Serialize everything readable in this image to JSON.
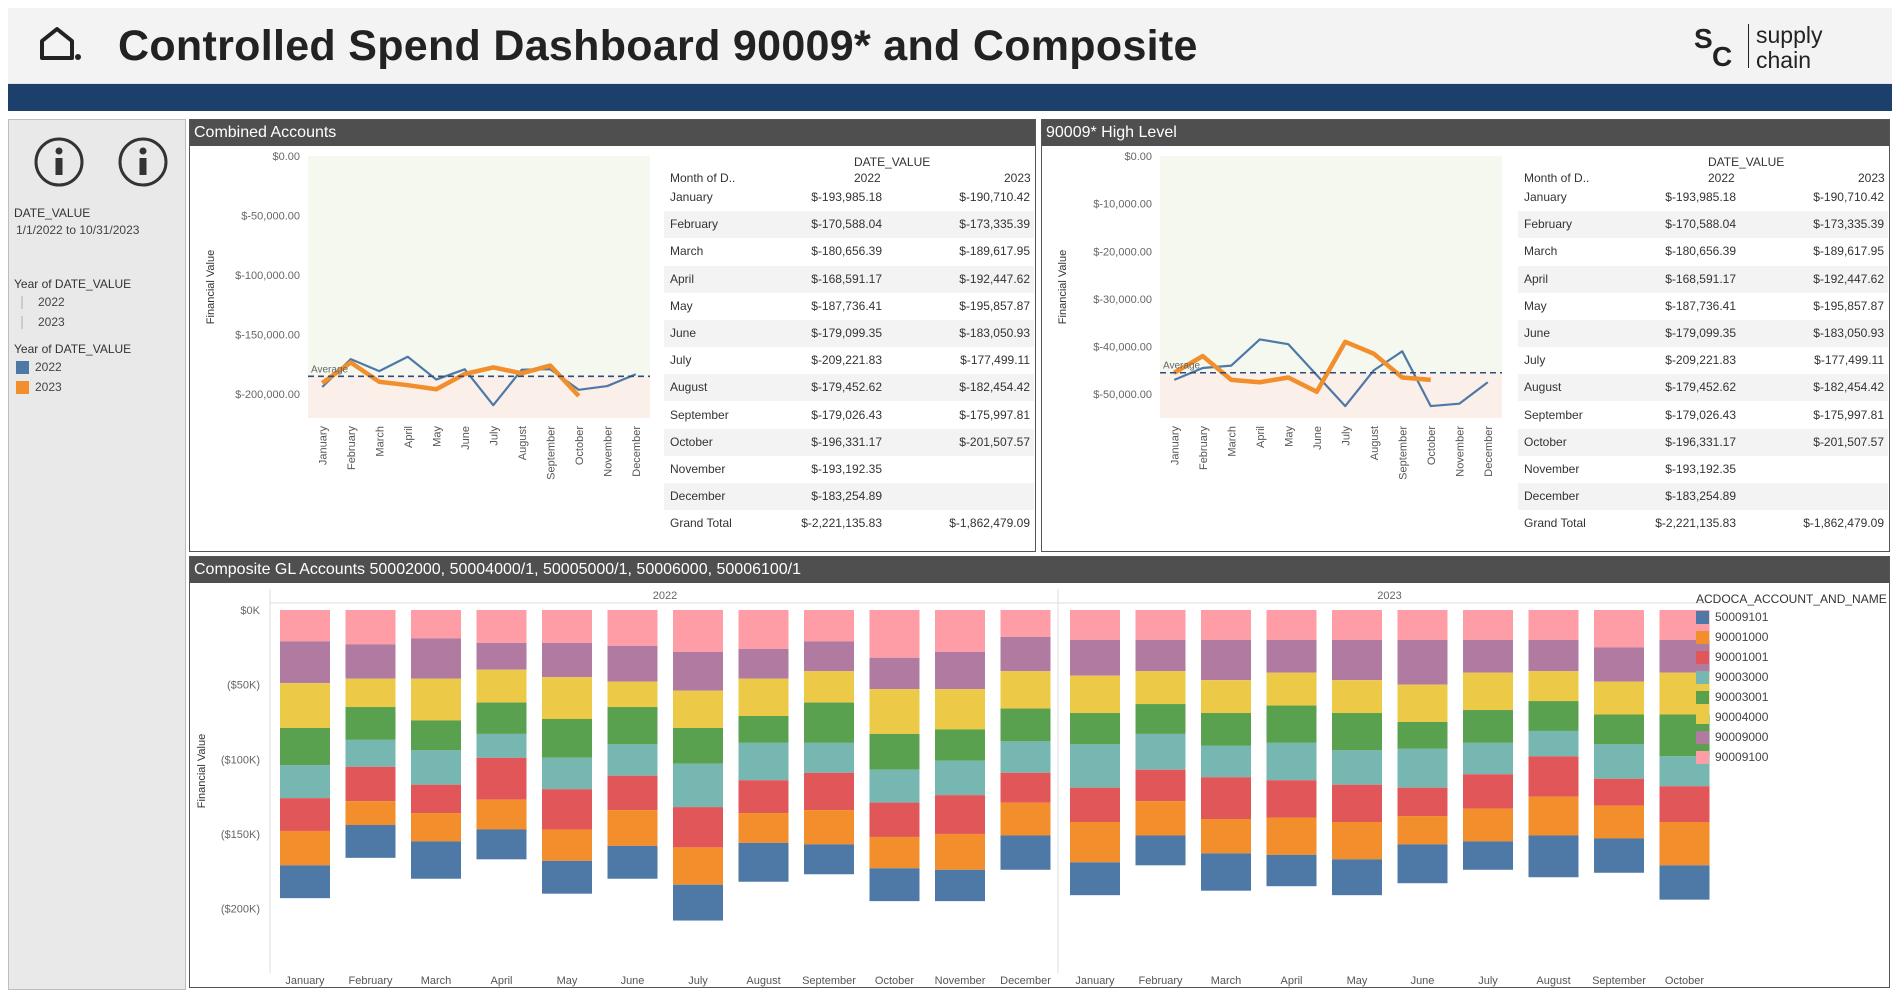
{
  "header": {
    "title": "Controlled Spend Dashboard 90009* and Composite",
    "logo_line1": "supply",
    "logo_line2": "chain",
    "logo_mark": "SC"
  },
  "sidebar": {
    "filter_title": "DATE_VALUE",
    "filter_value": "1/1/2022 to 10/31/2023",
    "legend1_title": "Year of DATE_VALUE",
    "legend1_items": [
      "2022",
      "2023"
    ],
    "legend2_title": "Year of DATE_VALUE",
    "legend2_items": [
      {
        "label": "2022",
        "color": "#4e79a7"
      },
      {
        "label": "2023",
        "color": "#f28e2b"
      }
    ]
  },
  "colors": {
    "y2022": "#4e79a7",
    "y2023": "#f28e2b",
    "average": "#2f4d7a"
  },
  "months": [
    "January",
    "February",
    "March",
    "April",
    "May",
    "June",
    "July",
    "August",
    "September",
    "October",
    "November",
    "December"
  ],
  "combined": {
    "panel_title": "Combined Accounts",
    "ylabel": "Financial Value",
    "avg_label": "Average",
    "yticks": [
      "$0.00",
      "$-50,000.00",
      "$-100,000.00",
      "$-150,000.00",
      "$-200,000.00"
    ],
    "table": {
      "top_header": "DATE_VALUE",
      "col0": "Month of D..",
      "col1": "2022",
      "col2": "2023",
      "rows": [
        [
          "January",
          "$-193,985.18",
          "$-190,710.42"
        ],
        [
          "February",
          "$-170,588.04",
          "$-173,335.39"
        ],
        [
          "March",
          "$-180,656.39",
          "$-189,617.95"
        ],
        [
          "April",
          "$-168,591.17",
          "$-192,447.62"
        ],
        [
          "May",
          "$-187,736.41",
          "$-195,857.87"
        ],
        [
          "June",
          "$-179,099.35",
          "$-183,050.93"
        ],
        [
          "July",
          "$-209,221.83",
          "$-177,499.11"
        ],
        [
          "August",
          "$-179,452.62",
          "$-182,454.42"
        ],
        [
          "September",
          "$-179,026.43",
          "$-175,997.81"
        ],
        [
          "October",
          "$-196,331.17",
          "$-201,507.57"
        ],
        [
          "November",
          "$-193,192.35",
          ""
        ],
        [
          "December",
          "$-183,254.89",
          ""
        ]
      ],
      "total": [
        "Grand Total",
        "$-2,221,135.83",
        "$-1,862,479.09"
      ]
    }
  },
  "high": {
    "panel_title": "90009* High Level",
    "ylabel": "Financial Value",
    "avg_label": "Average",
    "yticks": [
      "$0.00",
      "$-10,000.00",
      "$-20,000.00",
      "$-30,000.00",
      "$-40,000.00",
      "$-50,000.00"
    ],
    "table": {
      "top_header": "DATE_VALUE",
      "col0": "Month of D..",
      "col1": "2022",
      "col2": "2023",
      "rows": [
        [
          "January",
          "$-193,985.18",
          "$-190,710.42"
        ],
        [
          "February",
          "$-170,588.04",
          "$-173,335.39"
        ],
        [
          "March",
          "$-180,656.39",
          "$-189,617.95"
        ],
        [
          "April",
          "$-168,591.17",
          "$-192,447.62"
        ],
        [
          "May",
          "$-187,736.41",
          "$-195,857.87"
        ],
        [
          "June",
          "$-179,099.35",
          "$-183,050.93"
        ],
        [
          "July",
          "$-209,221.83",
          "$-177,499.11"
        ],
        [
          "August",
          "$-179,452.62",
          "$-182,454.42"
        ],
        [
          "September",
          "$-179,026.43",
          "$-175,997.81"
        ],
        [
          "October",
          "$-196,331.17",
          "$-201,507.57"
        ],
        [
          "November",
          "$-193,192.35",
          ""
        ],
        [
          "December",
          "$-183,254.89",
          ""
        ]
      ],
      "total": [
        "Grand Total",
        "$-2,221,135.83",
        "$-1,862,479.09"
      ]
    }
  },
  "composite": {
    "panel_title": "Composite GL Accounts 50002000, 50004000/1, 50005000/1, 50006000, 50006100/1",
    "ylabel": "Financial Value",
    "yticks": [
      "$0K",
      "($50K)",
      "($100K)",
      "($150K)",
      "($200K)"
    ],
    "year_labels": [
      "2022",
      "2023"
    ],
    "legend_title": "ACDOCA_ACCOUNT_AND_NAME",
    "legend": [
      {
        "label": "50009101",
        "color": "#4e79a7"
      },
      {
        "label": "90001000",
        "color": "#f28e2b"
      },
      {
        "label": "90001001",
        "color": "#e15759"
      },
      {
        "label": "90003000",
        "color": "#76b7b2"
      },
      {
        "label": "90003001",
        "color": "#59a14f"
      },
      {
        "label": "90004000",
        "color": "#edc948"
      },
      {
        "label": "90009000",
        "color": "#b07aa1"
      },
      {
        "label": "90009100",
        "color": "#ff9da7"
      }
    ],
    "x_labels_2023": [
      "January",
      "February",
      "March",
      "April",
      "May",
      "June",
      "July",
      "August",
      "September",
      "October"
    ]
  },
  "chart_data": [
    {
      "type": "line",
      "x": [
        "January",
        "February",
        "March",
        "April",
        "May",
        "June",
        "July",
        "August",
        "September",
        "October",
        "November",
        "December"
      ],
      "ylim": [
        -220000,
        0
      ],
      "ylabel": "Financial Value",
      "average": -185000,
      "series": [
        {
          "name": "2022",
          "values": [
            -193985.18,
            -170588.04,
            -180656.39,
            -168591.17,
            -187736.41,
            -179099.35,
            -209221.83,
            -179452.62,
            -179026.43,
            -196331.17,
            -193192.35,
            -183254.89
          ]
        },
        {
          "name": "2023",
          "values": [
            -190710.42,
            -173335.39,
            -189617.95,
            -192447.62,
            -195857.87,
            -183050.93,
            -177499.11,
            -182454.42,
            -175997.81,
            -201507.57,
            null,
            null
          ]
        }
      ]
    },
    {
      "type": "line",
      "x": [
        "January",
        "February",
        "March",
        "April",
        "May",
        "June",
        "July",
        "August",
        "September",
        "October",
        "November",
        "December"
      ],
      "ylim": [
        -55000,
        0
      ],
      "ylabel": "Financial Value",
      "average": -45500,
      "series": [
        {
          "name": "2022",
          "values": [
            -47000,
            -44500,
            -44000,
            -38500,
            -39500,
            -46000,
            -52500,
            -45000,
            -41000,
            -52500,
            -52000,
            -47500
          ]
        },
        {
          "name": "2023",
          "values": [
            -45500,
            -42000,
            -47000,
            -47500,
            -46500,
            -49500,
            -39000,
            -41500,
            -46500,
            -47000,
            null,
            null
          ]
        }
      ]
    },
    {
      "type": "bar",
      "stacked": true,
      "ylabel": "Financial Value",
      "ylim": [
        -215000,
        5000
      ],
      "categories": [
        "January 2022",
        "February 2022",
        "March 2022",
        "April 2022",
        "May 2022",
        "June 2022",
        "July 2022",
        "August 2022",
        "September 2022",
        "October 2022",
        "November 2022",
        "December 2022",
        "January 2023",
        "February 2023",
        "March 2023",
        "April 2023",
        "May 2023",
        "June 2023",
        "July 2023",
        "August 2023",
        "September 2023",
        "October 2023"
      ],
      "series": [
        {
          "name": "90009100",
          "values": [
            -21000,
            -23000,
            -19000,
            -22000,
            -22000,
            -24000,
            -28000,
            -26000,
            -21000,
            -32000,
            -28000,
            -18000,
            -20000,
            -20000,
            -20000,
            -20000,
            -20000,
            -20000,
            -20000,
            -20000,
            -25000,
            -20000
          ]
        },
        {
          "name": "90009000",
          "values": [
            -28000,
            -23000,
            -27000,
            -18000,
            -23000,
            -24000,
            -26000,
            -20000,
            -20000,
            -21000,
            -25000,
            -23000,
            -24000,
            -21000,
            -27000,
            -22000,
            -27000,
            -30000,
            -22000,
            -21000,
            -23000,
            -22000
          ]
        },
        {
          "name": "90004000",
          "values": [
            -30000,
            -19000,
            -28000,
            -22000,
            -28000,
            -17000,
            -25000,
            -25000,
            -21000,
            -30000,
            -27000,
            -25000,
            -25000,
            -22000,
            -22000,
            -22000,
            -22000,
            -25000,
            -25000,
            -20000,
            -22000,
            -28000
          ]
        },
        {
          "name": "90003001",
          "values": [
            -25000,
            -22000,
            -20000,
            -21000,
            -26000,
            -25000,
            -24000,
            -18000,
            -27000,
            -24000,
            -21000,
            -22000,
            -21000,
            -20000,
            -22000,
            -25000,
            -25000,
            -18000,
            -22000,
            -20000,
            -20000,
            -28000
          ]
        },
        {
          "name": "90003000",
          "values": [
            -22000,
            -18000,
            -23000,
            -16000,
            -21000,
            -21000,
            -29000,
            -25000,
            -20000,
            -22000,
            -23000,
            -21000,
            -29000,
            -24000,
            -21000,
            -25000,
            -23000,
            -26000,
            -21000,
            -17000,
            -23000,
            -20000
          ]
        },
        {
          "name": "90001001",
          "values": [
            -22000,
            -23000,
            -19000,
            -28000,
            -27000,
            -23000,
            -27000,
            -22000,
            -25000,
            -23000,
            -26000,
            -20000,
            -23000,
            -21000,
            -28000,
            -25000,
            -25000,
            -19000,
            -23000,
            -27000,
            -18000,
            -24000
          ]
        },
        {
          "name": "90001000",
          "values": [
            -23000,
            -16000,
            -19000,
            -20000,
            -21000,
            -24000,
            -25000,
            -20000,
            -23000,
            -21000,
            -24000,
            -22000,
            -27000,
            -23000,
            -23000,
            -25000,
            -25000,
            -19000,
            -22000,
            -26000,
            -22000,
            -29000
          ]
        },
        {
          "name": "50009101",
          "values": [
            -22000,
            -22000,
            -25000,
            -20000,
            -22000,
            -22000,
            -24000,
            -26000,
            -20000,
            -22000,
            -21000,
            -23000,
            -22000,
            -20000,
            -25000,
            -21000,
            -24000,
            -26000,
            -19000,
            -28000,
            -23000,
            -23000
          ]
        }
      ]
    }
  ]
}
